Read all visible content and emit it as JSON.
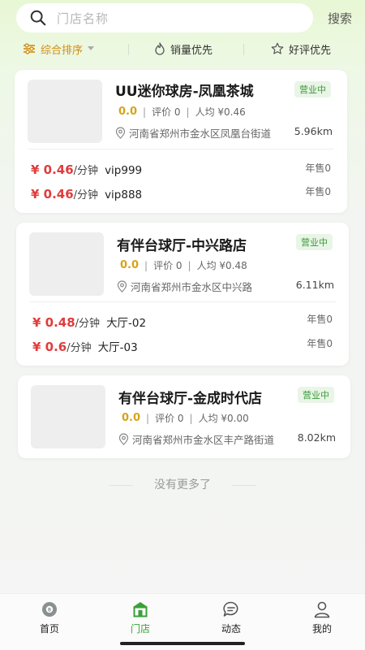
{
  "search": {
    "placeholder": "门店名称",
    "button_label": "搜索"
  },
  "filters": [
    {
      "label": "综合排序",
      "active": true,
      "icon": "sort-sliders-icon"
    },
    {
      "label": "销量优先",
      "active": false,
      "icon": "flame-icon"
    },
    {
      "label": "好评优先",
      "active": false,
      "icon": "star-icon"
    }
  ],
  "stores": [
    {
      "name": "UU迷你球房-凤凰茶城",
      "status": "营业中",
      "score": "0.0",
      "reviews": "评价 0",
      "avg_price": "人均 ¥0.46",
      "address": "河南省郑州市金水区凤凰台街道",
      "distance": "5.96km",
      "prices": [
        {
          "price": "¥ 0.46",
          "unit": "/分钟",
          "room": "vip999",
          "sold": "年售0"
        },
        {
          "price": "¥ 0.46",
          "unit": "/分钟",
          "room": "vip888",
          "sold": "年售0"
        }
      ]
    },
    {
      "name": "有伴台球厅-中兴路店",
      "status": "营业中",
      "score": "0.0",
      "reviews": "评价 0",
      "avg_price": "人均 ¥0.48",
      "address": "河南省郑州市金水区中兴路",
      "distance": "6.11km",
      "prices": [
        {
          "price": "¥ 0.48",
          "unit": "/分钟",
          "room": "大厅-02",
          "sold": "年售0"
        },
        {
          "price": "¥ 0.6",
          "unit": "/分钟",
          "room": "大厅-03",
          "sold": "年售0"
        }
      ]
    },
    {
      "name": "有伴台球厅-金成时代店",
      "status": "营业中",
      "score": "0.0",
      "reviews": "评价 0",
      "avg_price": "人均 ¥0.00",
      "address": "河南省郑州市金水区丰产路街道",
      "distance": "8.02km",
      "prices": []
    }
  ],
  "no_more_text": "没有更多了",
  "tabs": [
    {
      "label": "首页",
      "icon": "billiard-ball-icon",
      "active": false
    },
    {
      "label": "门店",
      "icon": "store-icon",
      "active": true
    },
    {
      "label": "动态",
      "icon": "chat-bubble-icon",
      "active": false
    },
    {
      "label": "我的",
      "icon": "user-icon",
      "active": false
    }
  ],
  "colors": {
    "accent_green": "#3aa03a",
    "price_red": "#e23b3b",
    "sort_orange": "#d38d13",
    "score_gold": "#d6a31a"
  }
}
